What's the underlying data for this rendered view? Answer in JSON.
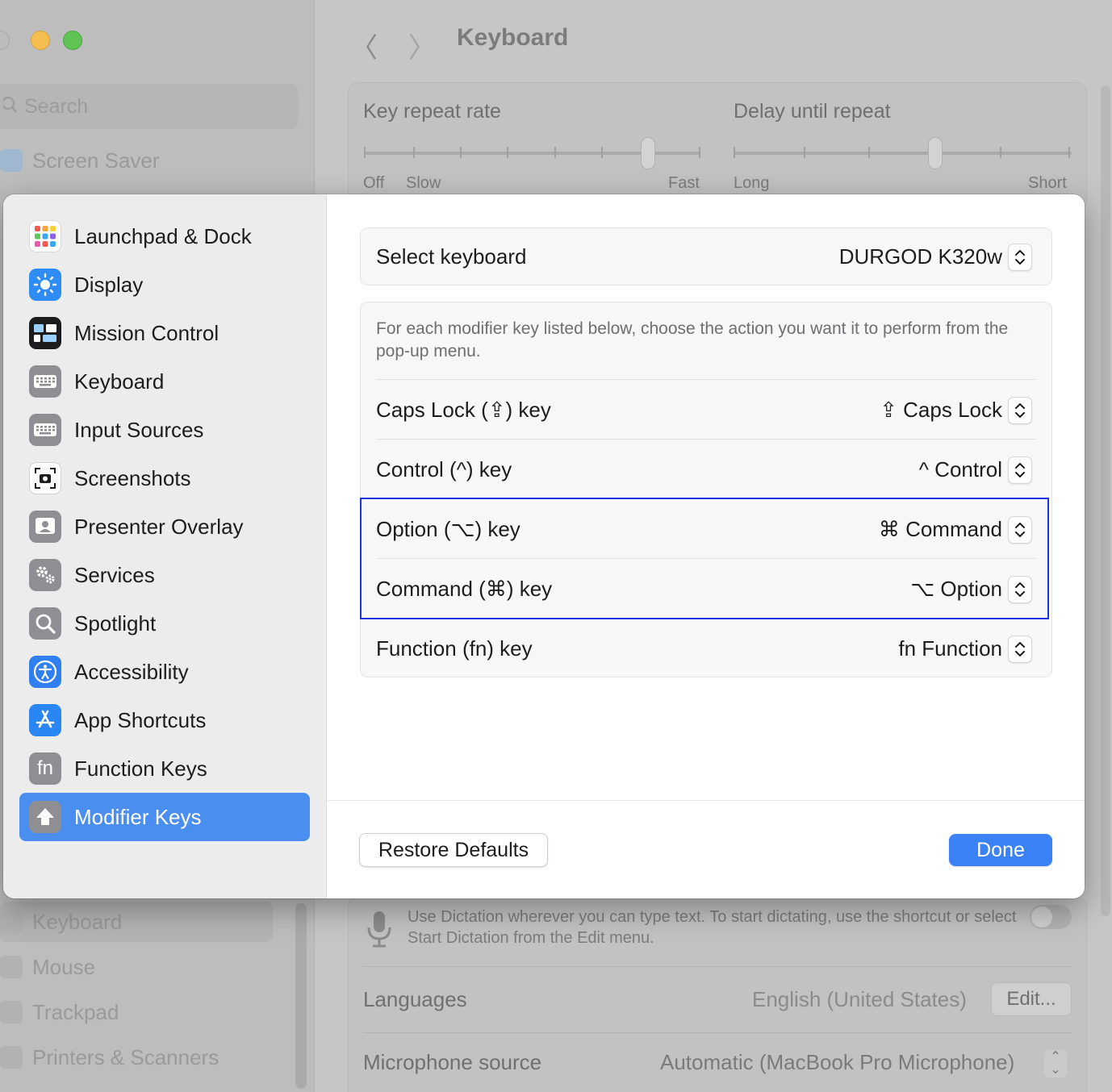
{
  "background_window": {
    "search_placeholder": "Search",
    "sidebar_items": [
      {
        "label": "Screen Saver"
      },
      {
        "label": "Keyboard"
      },
      {
        "label": "Mouse"
      },
      {
        "label": "Trackpad"
      },
      {
        "label": "Printers & Scanners"
      }
    ],
    "nav_back": "〈",
    "nav_forward": "〉",
    "title": "Keyboard",
    "key_repeat": {
      "label": "Key repeat rate",
      "left_off": "Off",
      "left_slow": "Slow",
      "right": "Fast",
      "level": 0.86
    },
    "delay_repeat": {
      "label": "Delay until repeat",
      "left": "Long",
      "right": "Short",
      "level": 0.6
    },
    "dictation_text": "Use Dictation wherever you can type text. To start dictating, use the shortcut or select Start Dictation from the Edit menu.",
    "dictation_enabled": false,
    "languages_label": "Languages",
    "languages_value": "English (United States)",
    "edit_button": "Edit...",
    "mic_source_label": "Microphone source",
    "mic_source_value": "Automatic (MacBook Pro Microphone)"
  },
  "dialog": {
    "sidebar": [
      {
        "label": "Launchpad & Dock",
        "icon": "launchpad-icon"
      },
      {
        "label": "Display",
        "icon": "display-icon"
      },
      {
        "label": "Mission Control",
        "icon": "mission-control-icon"
      },
      {
        "label": "Keyboard",
        "icon": "keyboard-icon"
      },
      {
        "label": "Input Sources",
        "icon": "input-sources-icon"
      },
      {
        "label": "Screenshots",
        "icon": "screenshots-icon"
      },
      {
        "label": "Presenter Overlay",
        "icon": "presenter-overlay-icon"
      },
      {
        "label": "Services",
        "icon": "services-icon"
      },
      {
        "label": "Spotlight",
        "icon": "spotlight-icon"
      },
      {
        "label": "Accessibility",
        "icon": "accessibility-icon"
      },
      {
        "label": "App Shortcuts",
        "icon": "app-shortcuts-icon"
      },
      {
        "label": "Function Keys",
        "icon": "function-keys-icon",
        "glyph": "fn"
      },
      {
        "label": "Modifier Keys",
        "icon": "modifier-keys-icon",
        "selected": true
      }
    ],
    "select_keyboard_label": "Select keyboard",
    "select_keyboard_value": "DURGOD K320w",
    "description": "For each modifier key listed below, choose the action you want it to perform from the pop-up menu.",
    "rows": [
      {
        "label": "Caps Lock (⇪) key",
        "value": "⇪ Caps Lock"
      },
      {
        "label": "Control (^) key",
        "value": "^ Control"
      },
      {
        "label": "Option (⌥) key",
        "value": "⌘ Command"
      },
      {
        "label": "Command (⌘) key",
        "value": "⌥ Option"
      },
      {
        "label": "Function (fn) key",
        "value": "fn Function"
      }
    ],
    "restore_button": "Restore Defaults",
    "done_button": "Done"
  },
  "colors": {
    "accent": "#3b82f6",
    "selection": "#4a8ef0",
    "highlight_border": "#1d33e0"
  }
}
